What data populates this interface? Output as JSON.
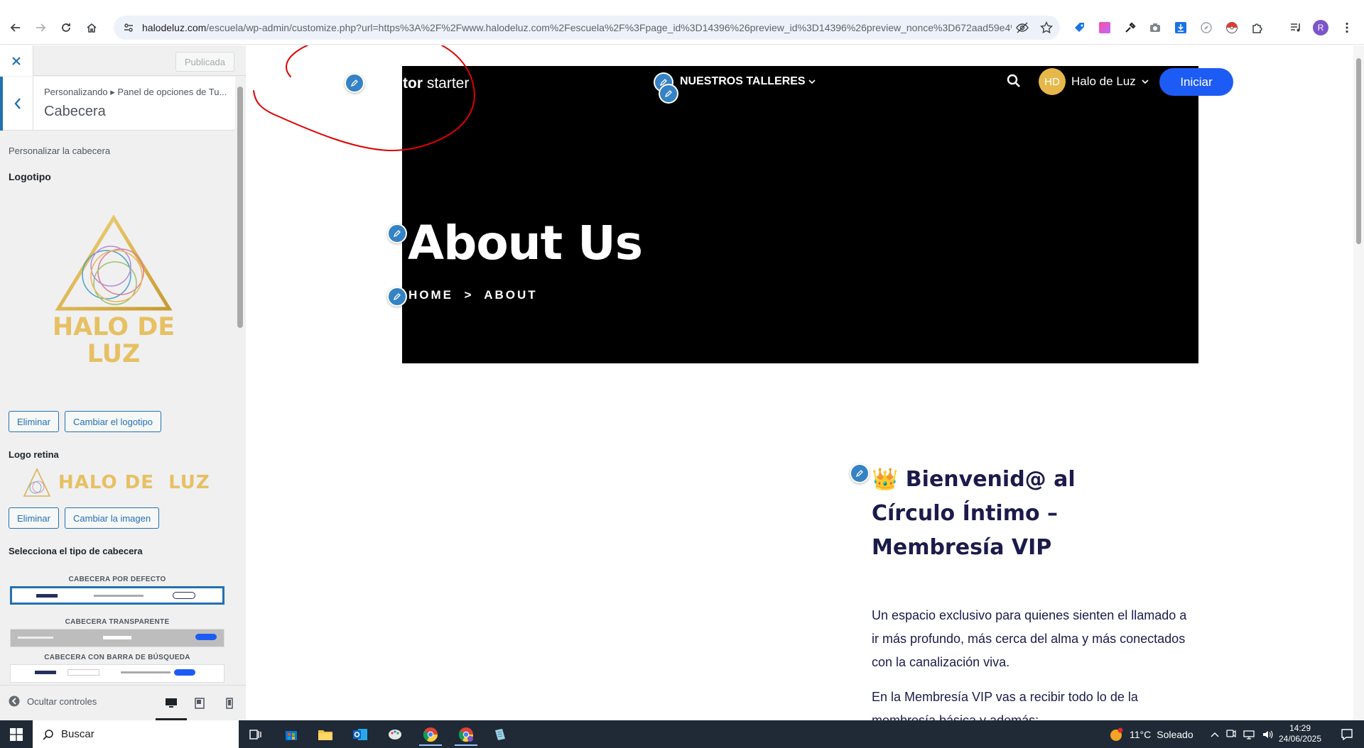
{
  "browser": {
    "url_host": "halodeluz.com",
    "url_rest": "/escuela/wp-admin/customize.php?url=https%3A%2F%2Fwww.halodeluz.com%2Fescuela%2F%3Fpage_id%3D14396%26preview_id%3D14396%26preview_nonce%3D672aad59e4%2...",
    "profile_initial": "R"
  },
  "customizer": {
    "publish_label": "Publicada",
    "breadcrumb": "Personalizando ▸ Panel de opciones de Tu...",
    "section_title": "Cabecera",
    "description": "Personalizar la cabecera",
    "logo_label": "Logotipo",
    "logo_text_line1": "HALO DE",
    "logo_text_line2": "LUZ",
    "remove_label": "Eliminar",
    "change_logo_label": "Cambiar el logotipo",
    "retina_label": "Logo retina",
    "retina_text": "HALO DE  LUZ",
    "remove_label_2": "Eliminar",
    "change_image_label": "Cambiar la imagen",
    "header_type_label": "Selecciona el tipo de cabecera",
    "header_options": [
      {
        "title": "CABECERA POR DEFECTO",
        "selected": true
      },
      {
        "title": "CABECERA TRANSPARENTE",
        "selected": false
      },
      {
        "title": "CABECERA CON BARRA DE BÚSQUEDA",
        "selected": false
      }
    ],
    "hide_controls_label": "Ocultar controles"
  },
  "preview": {
    "site_title_bold": "tor",
    "site_title_rest": " starter",
    "nav_item": "NUESTROS TALLERES",
    "user_initials": "HD",
    "user_name": "Halo de Luz",
    "login_button": "Iniciar",
    "hero_title": "About Us",
    "hero_breadcrumb": "HOME  >  ABOUT",
    "content_heading": "👑 Bienvenid@ al Círculo Íntimo – Membresía VIP",
    "paragraph_1": "Un espacio exclusivo para quienes sienten el llamado a ir más profundo, más cerca del alma y más conectados con la canalización viva.",
    "paragraph_2": "En la Membresía VIP vas a recibir todo lo de la membresía básica y además:"
  },
  "taskbar": {
    "search_placeholder": "Buscar",
    "temperature": "11°C",
    "weather_text": "Soleado",
    "time": "14:29",
    "date": "24/06/2025"
  },
  "colors": {
    "wp_blue": "#2271b1",
    "hero_bg": "#000000",
    "login_button": "#1d5cf4",
    "logo_gold": "#e6c063",
    "heading_navy": "#1b1b4b",
    "scribble_red": "#e00000"
  }
}
